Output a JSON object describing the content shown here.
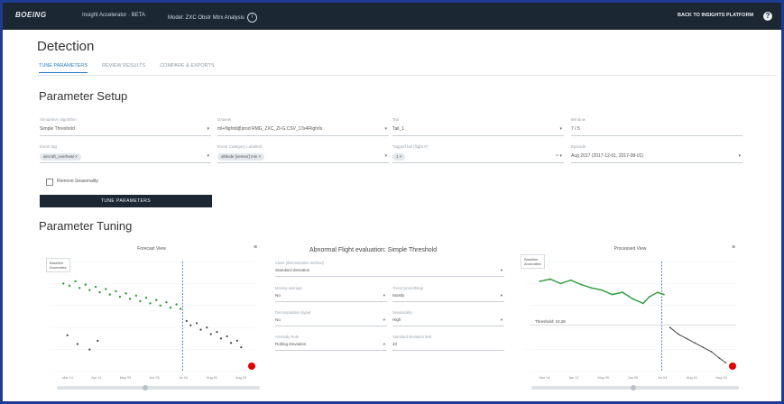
{
  "topbar": {
    "logo": "BOEING",
    "app_name": "Insight Accelerator · BETA",
    "model_name": "Model: ZXC Obstr Mtrx Analysis",
    "back_link": "BACK TO INSIGHTS PLATFORM",
    "help": "?"
  },
  "page": {
    "title": "Detection",
    "tabs": [
      "TUNE PARAMETERS",
      "REVIEW RESULTS",
      "COMPARE & EXPORTS"
    ],
    "active_tab": 0
  },
  "setup": {
    "heading": "Parameter Setup",
    "fields": [
      {
        "label": "Simulation algorithm",
        "value": "Simple Threshold",
        "type": "select"
      },
      {
        "label": "Dataset",
        "value": "ml+flightd@prod RMG_ZXC_ZI-G.CSV_1Ts4FlightIx",
        "type": "select"
      },
      {
        "label": "Tail",
        "value": "Tail_1",
        "type": "select"
      },
      {
        "label": "Window",
        "value": "7 / 5",
        "type": "text"
      },
      {
        "label": "Event tag",
        "chip": "aircraft_overheat ×",
        "type": "chips"
      },
      {
        "label": "Event Category Labelled",
        "chip": "altitude [sensor] min ×",
        "type": "chips"
      },
      {
        "label": "Tagged tail (flight #)",
        "chip": "1 ×",
        "type": "chips"
      },
      {
        "label": "Episode",
        "value": "Aug 2017 (2017-12-01, 2017-08-01)",
        "type": "select"
      }
    ],
    "checkbox_label": "Remove Seasonality",
    "tune_button": "TUNE PARAMETERS"
  },
  "tuning": {
    "heading": "Parameter Tuning",
    "left_chart_title": "Forecast View",
    "right_chart_title": "Processed View",
    "mid_title": "Abnormal Flight evaluation: Simple Threshold",
    "mid_fields": [
      {
        "label": "Class (discretization method)",
        "value": "Standard deviation"
      },
      {
        "label": "Moving average",
        "value": "No"
      },
      {
        "label": "Trend (smoothing)",
        "value": "Mostly"
      },
      {
        "label": "Decomposition (type)",
        "value": "No"
      },
      {
        "label": "Seasonality",
        "value": "High"
      },
      {
        "label": "Anomaly Rule",
        "value": "Rolling Deviation"
      },
      {
        "label": "Standard deviation limit",
        "value": "40"
      }
    ],
    "legend_labels": [
      "Baseline",
      "Anomalies"
    ],
    "right_annotation": "Threshold: 10.28",
    "x_ticks": [
      "Mar 14",
      "Apr 11",
      "May 09",
      "Jun 06",
      "Jul 04",
      "Aug 01",
      "Aug 29"
    ],
    "colors": {
      "normal": "#2e9a3a",
      "anomaly": "#444444",
      "marker": "#e00000",
      "vline": "#3b5bdb"
    }
  },
  "chart_data": [
    {
      "type": "scatter",
      "title": "Forecast View",
      "xlabel": "",
      "ylabel": "",
      "series": [
        {
          "values": [
            [
              0.05,
              0.8
            ],
            [
              0.08,
              0.78
            ],
            [
              0.11,
              0.82
            ],
            [
              0.13,
              0.76
            ],
            [
              0.16,
              0.79
            ],
            [
              0.18,
              0.74
            ],
            [
              0.21,
              0.77
            ],
            [
              0.23,
              0.72
            ],
            [
              0.26,
              0.75
            ],
            [
              0.28,
              0.7
            ],
            [
              0.31,
              0.73
            ],
            [
              0.33,
              0.68
            ],
            [
              0.36,
              0.71
            ],
            [
              0.38,
              0.66
            ],
            [
              0.41,
              0.69
            ],
            [
              0.43,
              0.64
            ],
            [
              0.46,
              0.67
            ],
            [
              0.48,
              0.62
            ],
            [
              0.51,
              0.65
            ],
            [
              0.53,
              0.6
            ],
            [
              0.56,
              0.63
            ],
            [
              0.58,
              0.58
            ],
            [
              0.61,
              0.61
            ],
            [
              0.63,
              0.57
            ]
          ]
        },
        {
          "values": [
            [
              0.66,
              0.46
            ],
            [
              0.68,
              0.42
            ],
            [
              0.71,
              0.44
            ],
            [
              0.73,
              0.38
            ],
            [
              0.76,
              0.4
            ],
            [
              0.78,
              0.34
            ],
            [
              0.81,
              0.36
            ],
            [
              0.83,
              0.3
            ],
            [
              0.86,
              0.32
            ],
            [
              0.88,
              0.26
            ],
            [
              0.91,
              0.28
            ],
            [
              0.93,
              0.22
            ],
            [
              0.12,
              0.25
            ],
            [
              0.18,
              0.2
            ],
            [
              0.22,
              0.28
            ],
            [
              0.07,
              0.33
            ]
          ]
        }
      ]
    },
    {
      "type": "line",
      "title": "Processed View",
      "xlabel": "",
      "ylabel": "",
      "series": [
        {
          "values": [
            [
              0.05,
              0.82
            ],
            [
              0.1,
              0.84
            ],
            [
              0.15,
              0.8
            ],
            [
              0.2,
              0.83
            ],
            [
              0.25,
              0.79
            ],
            [
              0.3,
              0.76
            ],
            [
              0.35,
              0.74
            ],
            [
              0.4,
              0.7
            ],
            [
              0.45,
              0.72
            ],
            [
              0.5,
              0.66
            ],
            [
              0.55,
              0.62
            ],
            [
              0.58,
              0.68
            ],
            [
              0.62,
              0.72
            ],
            [
              0.65,
              0.7
            ]
          ]
        },
        {
          "values": [
            [
              0.68,
              0.4
            ],
            [
              0.72,
              0.34
            ],
            [
              0.76,
              0.3
            ],
            [
              0.8,
              0.26
            ],
            [
              0.84,
              0.22
            ],
            [
              0.88,
              0.18
            ],
            [
              0.92,
              0.12
            ],
            [
              0.95,
              0.08
            ]
          ]
        }
      ]
    }
  ]
}
